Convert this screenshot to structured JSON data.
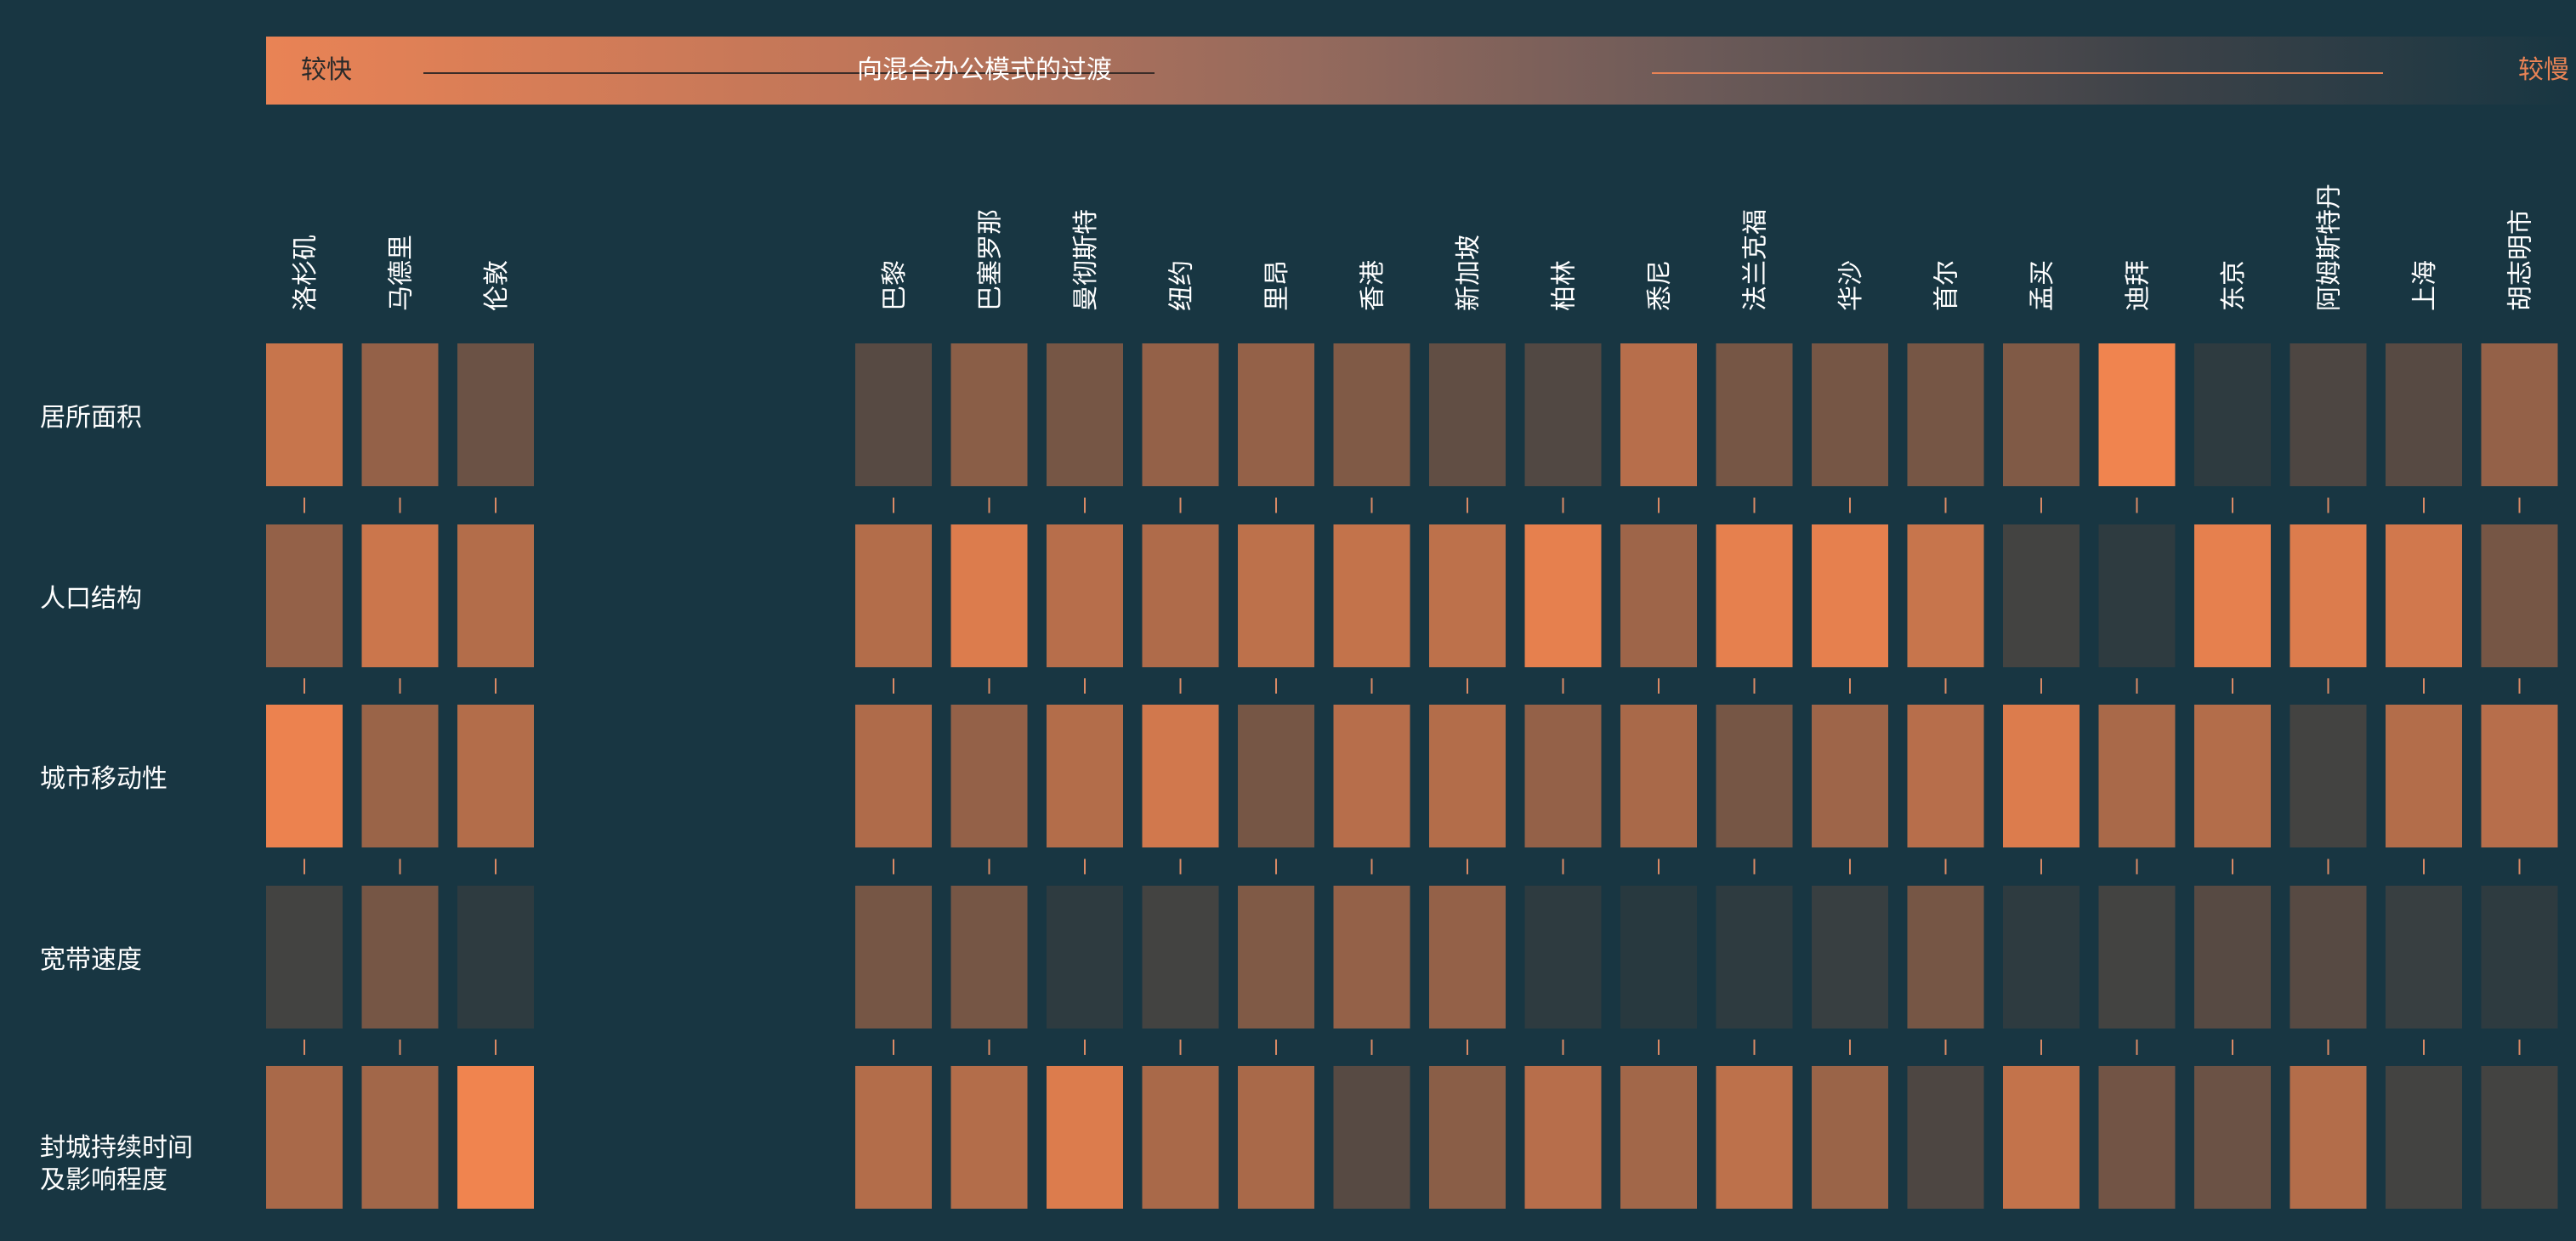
{
  "header": {
    "left_label": "较快",
    "title": "向混合办公模式的过渡",
    "right_label": "较慢"
  },
  "colors": {
    "background": "#183642",
    "high": "#f0844f",
    "low": "#24373f",
    "connector": "#d98a66"
  },
  "chart_data": {
    "type": "heatmap",
    "title": "向混合办公模式的过渡",
    "x_scale_labels": [
      "较快",
      "较慢"
    ],
    "groups": [
      {
        "cities": [
          "洛杉矶",
          "马德里",
          "伦敦"
        ]
      },
      {
        "cities": [
          "巴黎",
          "巴塞罗那",
          "曼彻斯特",
          "纽约",
          "里昂",
          "香港",
          "新加坡",
          "柏林",
          "悉尼",
          "法兰克福",
          "华沙",
          "首尔",
          "孟买",
          "迪拜",
          "东京",
          "阿姆斯特丹",
          "上海",
          "胡志明市"
        ]
      }
    ],
    "rows": [
      "居所面积",
      "人口结构",
      "城市移动性",
      "宽带速度",
      "封城持续时间\n及影响程度"
    ],
    "value_range": [
      0,
      1
    ],
    "values": [
      [
        0.8,
        0.55,
        0.35,
        0.25,
        0.5,
        0.4,
        0.55,
        0.55,
        0.45,
        0.3,
        0.22,
        0.72,
        0.4,
        0.4,
        0.4,
        0.45,
        1.0,
        0.05,
        0.2,
        0.25,
        0.55
      ],
      [
        0.55,
        0.82,
        0.7,
        0.7,
        0.9,
        0.72,
        0.68,
        0.75,
        0.78,
        0.75,
        0.95,
        0.6,
        0.95,
        0.95,
        0.8,
        0.15,
        0.05,
        0.95,
        0.9,
        0.85,
        0.4
      ],
      [
        0.98,
        0.58,
        0.7,
        0.68,
        0.55,
        0.7,
        0.85,
        0.4,
        0.72,
        0.7,
        0.55,
        0.65,
        0.4,
        0.6,
        0.72,
        0.9,
        0.65,
        0.7,
        0.15,
        0.7,
        0.72
      ],
      [
        0.15,
        0.4,
        0.05,
        0.4,
        0.4,
        0.05,
        0.15,
        0.45,
        0.55,
        0.55,
        0.05,
        0.02,
        0.05,
        0.1,
        0.4,
        0.05,
        0.15,
        0.25,
        0.25,
        0.1,
        0.05
      ],
      [
        0.65,
        0.62,
        1.0,
        0.7,
        0.7,
        0.9,
        0.65,
        0.65,
        0.25,
        0.5,
        0.72,
        0.62,
        0.75,
        0.58,
        0.2,
        0.78,
        0.38,
        0.35,
        0.7,
        0.15,
        0.15
      ]
    ]
  }
}
